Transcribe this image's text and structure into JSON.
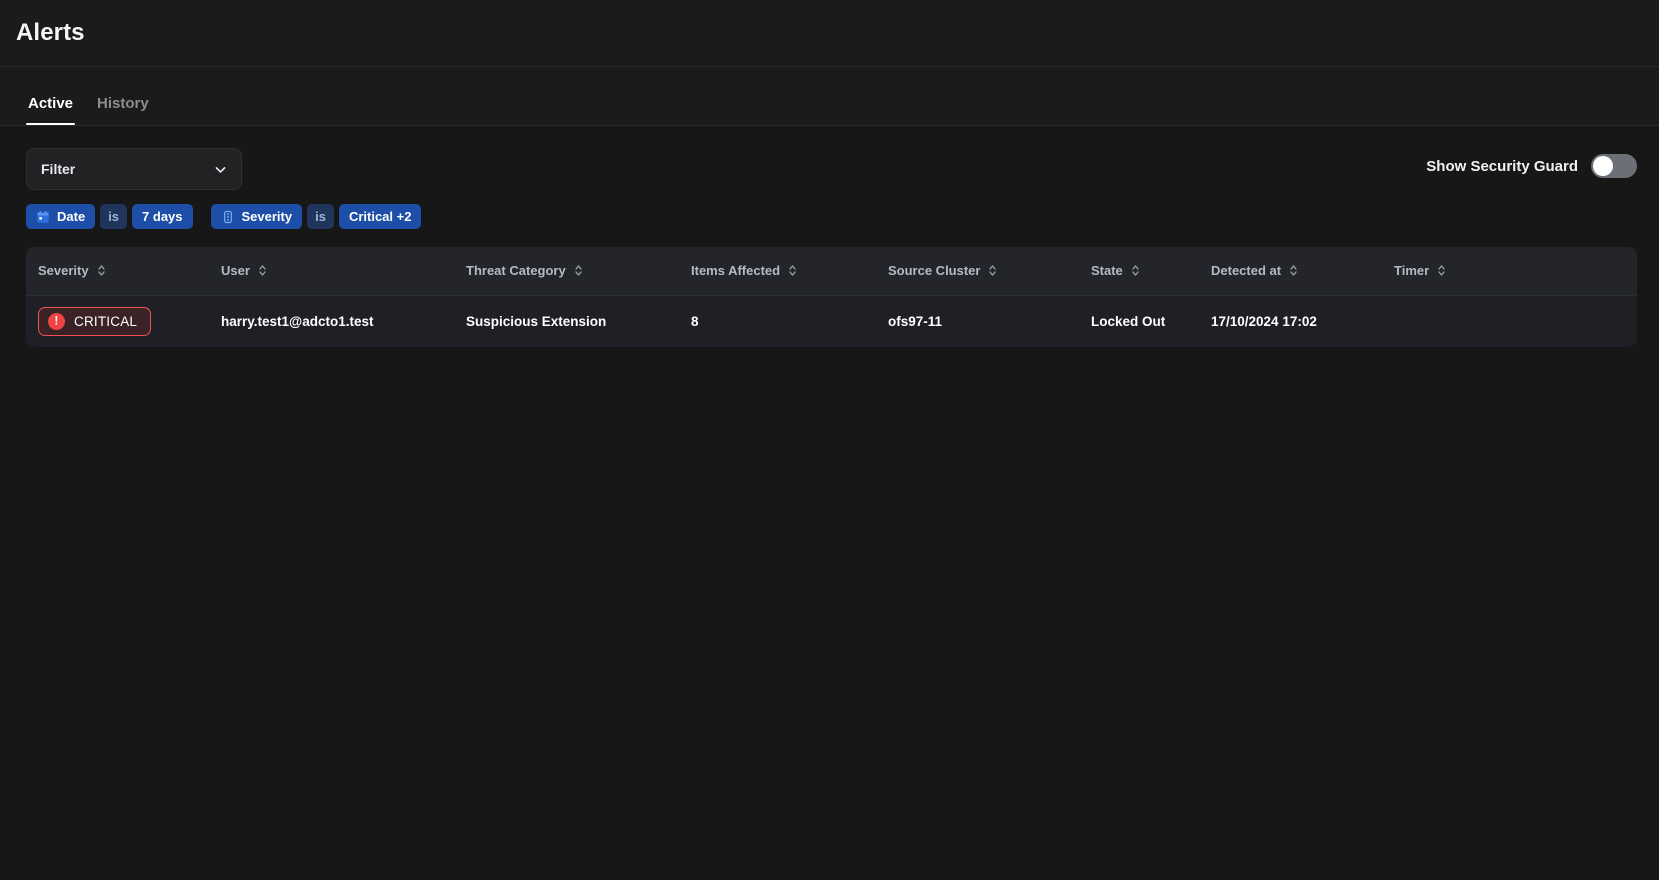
{
  "header": {
    "title": "Alerts"
  },
  "tabs": [
    {
      "label": "Active",
      "active": true
    },
    {
      "label": "History",
      "active": false
    }
  ],
  "filter": {
    "label": "Filter",
    "chevron_icon": "chevron-down-icon",
    "chips": [
      {
        "icon": "calendar-icon",
        "label": "Date",
        "kind": "field"
      },
      {
        "label": "is",
        "kind": "operator"
      },
      {
        "label": "7 days",
        "kind": "value"
      },
      {
        "icon": "severity-icon",
        "label": "Severity",
        "kind": "field"
      },
      {
        "label": "is",
        "kind": "operator"
      },
      {
        "label": "Critical +2",
        "kind": "value"
      }
    ]
  },
  "security_guard": {
    "label": "Show Security Guard",
    "enabled": false
  },
  "table": {
    "columns": [
      {
        "label": "Severity",
        "sortable": true
      },
      {
        "label": "User",
        "sortable": true
      },
      {
        "label": "Threat Category",
        "sortable": true
      },
      {
        "label": "Items Affected",
        "sortable": true
      },
      {
        "label": "Source Cluster",
        "sortable": true
      },
      {
        "label": "State",
        "sortable": true
      },
      {
        "label": "Detected at",
        "sortable": true
      },
      {
        "label": "Timer",
        "sortable": true
      }
    ],
    "rows": [
      {
        "severity": "CRITICAL",
        "severity_icon": "alert-circle-icon",
        "user": "harry.test1@adcto1.test",
        "threat_category": "Suspicious Extension",
        "items_affected": "8",
        "source_cluster": "ofs97-11",
        "state": "Locked Out",
        "detected_at": "17/10/2024 17:02",
        "timer": ""
      }
    ]
  },
  "colors": {
    "page_bg": "#171717",
    "panel_bg": "#1b1b1b",
    "table_header_bg": "#23252b",
    "table_row_bg": "#1e2026",
    "chip_blue": "#1d4fa8",
    "chip_op_blue": "#20355c",
    "critical_red": "#f05252",
    "critical_fill": "#3a2227",
    "toggle_off": "#6b7076",
    "accent_text": "#ffffff"
  }
}
